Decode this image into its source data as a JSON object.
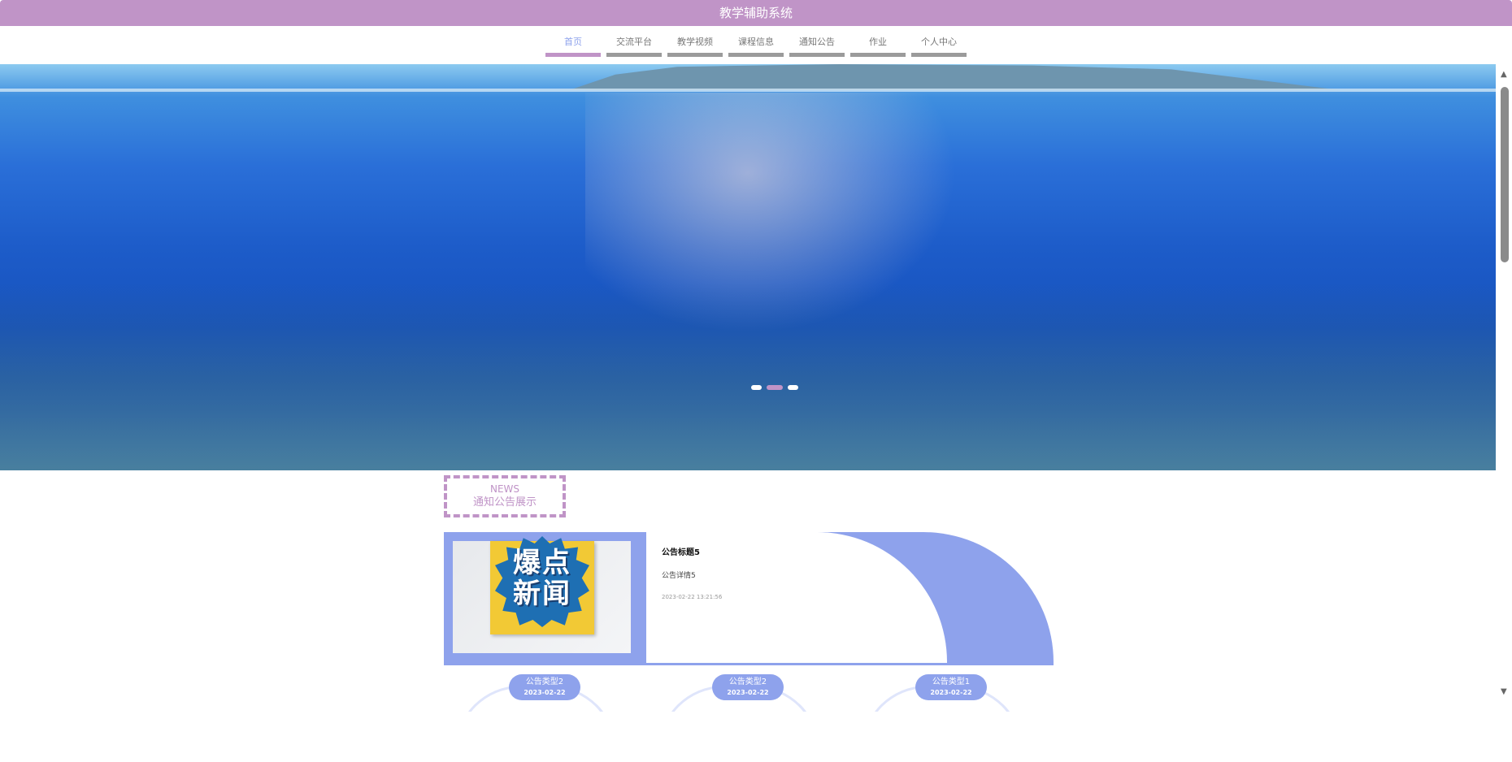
{
  "header": {
    "title": "教学辅助系统"
  },
  "nav": {
    "items": [
      {
        "label": "首页"
      },
      {
        "label": "交流平台"
      },
      {
        "label": "教学视频"
      },
      {
        "label": "课程信息"
      },
      {
        "label": "通知公告"
      },
      {
        "label": "作业"
      },
      {
        "label": "个人中心"
      }
    ],
    "active_index": 0
  },
  "carousel": {
    "slide_count": 3,
    "active_slide": 2
  },
  "news_section": {
    "title_en": "NEWS",
    "title_cn": "通知公告展示"
  },
  "featured_notice": {
    "image_text": "爆点新闻",
    "title": "公告标题5",
    "detail": "公告详情5",
    "time": "2023-02-22 13:21:56"
  },
  "notice_types": [
    {
      "name": "公告类型2",
      "date": "2023-02-22"
    },
    {
      "name": "公告类型2",
      "date": "2023-02-22"
    },
    {
      "name": "公告类型1",
      "date": "2023-02-22"
    }
  ],
  "colors": {
    "header": "#c094c7",
    "accent": "#8ea2ec",
    "nav_underline": "#9b9b9b"
  }
}
